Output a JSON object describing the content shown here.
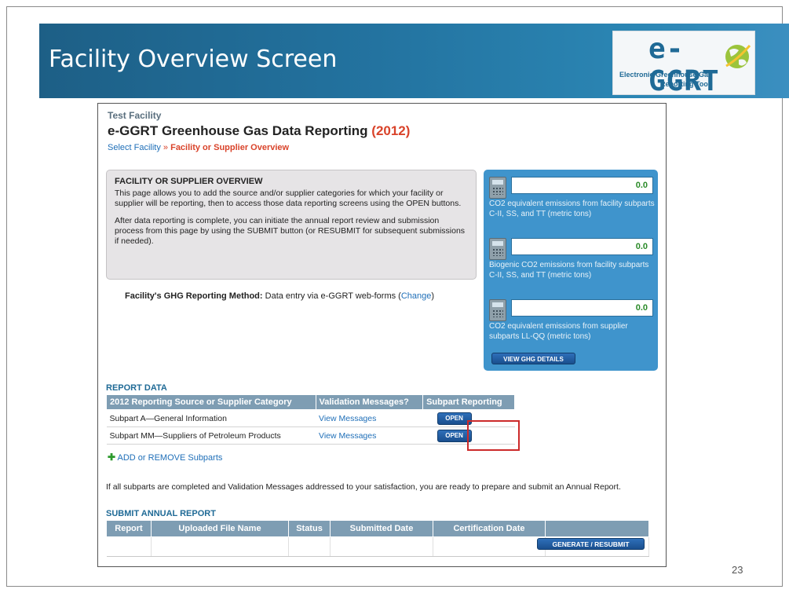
{
  "slide": {
    "title": "Facility Overview Screen",
    "page_number": "23",
    "logo": {
      "main": "e-GGRT",
      "sub_line1": "Electronic Greenhouse Gas",
      "sub_line2": "Reporting Tool"
    }
  },
  "header": {
    "facility_name": "Test Facility",
    "title": "e-GGRT Greenhouse Gas Data Reporting ",
    "year": "(2012)",
    "breadcrumb": {
      "link": "Select Facility",
      "separator": " » ",
      "current": "Facility or Supplier Overview"
    }
  },
  "overview": {
    "title": "FACILITY OR SUPPLIER OVERVIEW",
    "para1": "This page allows you to add the source and/or supplier categories for which your facility or supplier will be reporting, then to access those data reporting screens using the OPEN buttons.",
    "para2": "After data reporting is complete, you can initiate the annual report review and submission process from this page by using the SUBMIT button (or RESUBMIT for subsequent submissions if needed)."
  },
  "method": {
    "label": "Facility's GHG Reporting Method:",
    "value": " Data entry via e-GGRT web-forms (",
    "change_link": "Change",
    "close": ")"
  },
  "emissions": {
    "items": [
      {
        "value": "0.0",
        "label": "CO2 equivalent emissions from facility subparts C-II, SS, and TT (metric tons)"
      },
      {
        "value": "0.0",
        "label": "Biogenic CO2 emissions from facility subparts C-II, SS, and TT (metric tons)"
      },
      {
        "value": "0.0",
        "label": "CO2 equivalent emissions from supplier subparts LL-QQ (metric tons)"
      }
    ],
    "details_button": "VIEW GHG DETAILS"
  },
  "report_data": {
    "heading": "REPORT DATA",
    "columns": [
      "2012 Reporting Source or Supplier Category",
      "Validation Messages?",
      "Subpart Reporting"
    ],
    "rows": [
      {
        "category": "Subpart A—General Information",
        "messages": "View Messages",
        "action": "OPEN"
      },
      {
        "category": "Subpart MM—Suppliers of Petroleum Products",
        "messages": "View Messages",
        "action": "OPEN"
      }
    ],
    "add_remove": "ADD or REMOVE Subparts"
  },
  "submit": {
    "ready_text": "If all subparts are completed and Validation Messages addressed to your satisfaction, you are ready to prepare and submit an Annual Report.",
    "heading": "SUBMIT ANNUAL REPORT",
    "columns": [
      "Report",
      "Uploaded File Name",
      "Status",
      "Submitted Date",
      "Certification Date",
      ""
    ],
    "button": "GENERATE / RESUBMIT"
  },
  "colors": {
    "banner": "#2373a0",
    "accent_red": "#d9432a",
    "link_blue": "#1f6fb8",
    "emissions_panel": "#3f94cc",
    "table_header": "#7e9db3",
    "highlight": "#cc2a2a"
  }
}
